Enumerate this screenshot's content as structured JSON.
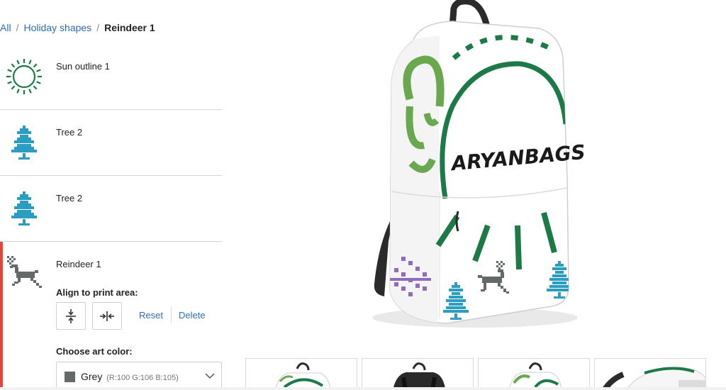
{
  "breadcrumb": {
    "items": [
      "All",
      "Holiday shapes"
    ],
    "separator": "/",
    "current": "Reindeer 1"
  },
  "art_list": [
    {
      "label": "Sun outline 1",
      "icon": "sun-outline-icon",
      "color": "#1c7a47"
    },
    {
      "label": "Tree 2",
      "icon": "pixel-tree-icon",
      "color": "#2a9dc0"
    },
    {
      "label": "Tree 2",
      "icon": "pixel-tree-icon",
      "color": "#2a9dc0"
    }
  ],
  "selected_art": {
    "label": "Reindeer 1",
    "icon": "pixel-reindeer-icon",
    "accent_color": "#e2463a",
    "align_title": "Align to print area:",
    "align_vertical_icon": "align-vertical-center-icon",
    "align_horizontal_icon": "align-horizontal-center-icon",
    "reset_label": "Reset",
    "delete_label": "Delete",
    "color_title": "Choose art color:",
    "color_name": "Grey",
    "color_values": "(R:100 G:106 B:105)",
    "color_hex": "#646a69"
  },
  "product": {
    "brand_text": "ARYANBAGS",
    "green_color": "#1c7a47",
    "light_green_color": "#6aa84f",
    "purple_color": "#8e6cc0",
    "tree_color": "#2a9dc0",
    "reindeer_color": "#646a69"
  },
  "thumbnails": [
    {
      "name": "backpack-front-view"
    },
    {
      "name": "backpack-back-view"
    },
    {
      "name": "backpack-side-view"
    },
    {
      "name": "backpack-detail-view"
    }
  ]
}
